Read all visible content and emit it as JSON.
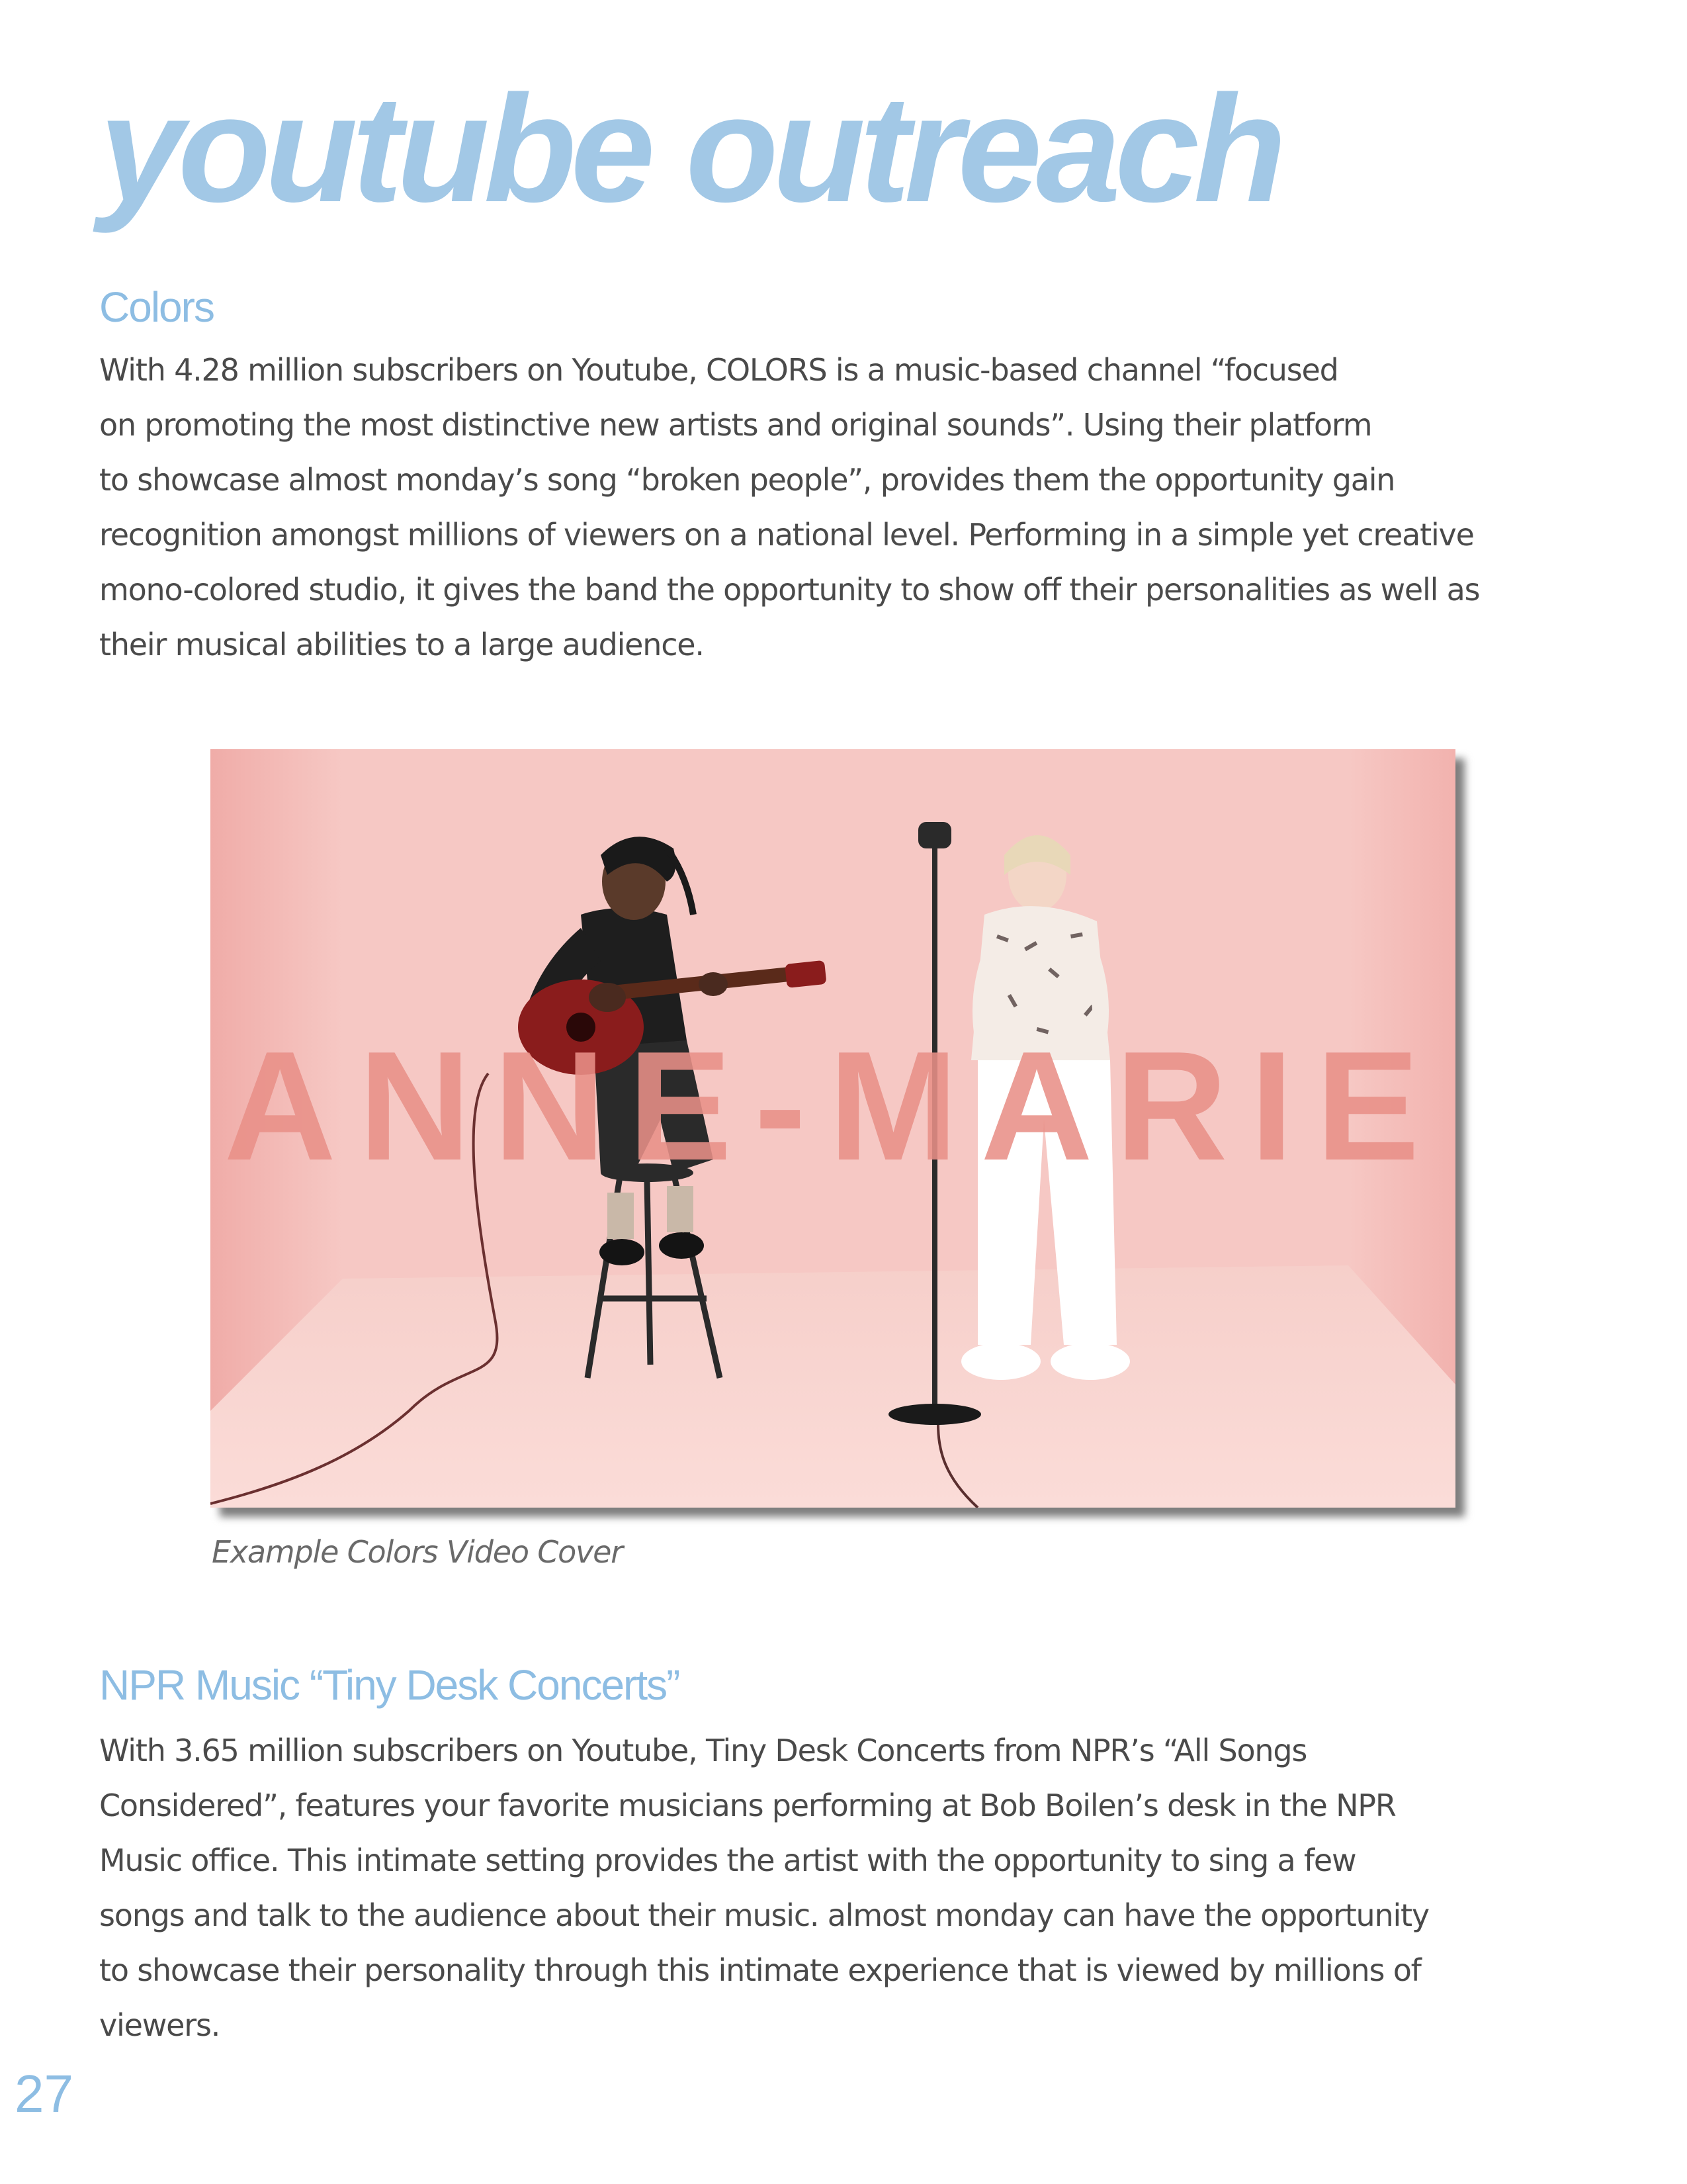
{
  "page": {
    "title": "youtube outreach",
    "page_number": "27"
  },
  "colors_section": {
    "heading": "Colors",
    "lines": [
      "With 4.28 million subscribers on Youtube, COLORS is a music-based channel “focused",
      "on promoting the most distinctive new artists and original sounds”. Using their platform",
      "to showcase almost monday’s song “broken people”, provides them the opportunity gain",
      "recognition amongst millions of viewers on a national level. Performing in a simple yet creative",
      "mono-colored studio, it gives the band the opportunity to show off their personalities as well as",
      "their musical abilities to a large audience."
    ]
  },
  "video_cover": {
    "overlay_text": "ANNE-MARIE",
    "caption": "Example Colors Video Cover",
    "colors": {
      "background": "#f4c4c0",
      "overlay_text": "#e89088"
    }
  },
  "npr_section": {
    "heading": "NPR Music “Tiny Desk Concerts”",
    "lines": [
      "With 3.65 million subscribers on Youtube, Tiny Desk Concerts from NPR’s “All Songs",
      "Considered”, features your favorite musicians performing at Bob Boilen’s desk in the NPR",
      "Music office. This intimate setting provides the artist with the opportunity to sing a few",
      "songs and talk to the audience about their music. almost monday can have the opportunity",
      "to showcase their personality through this intimate experience that is viewed by millions of",
      "viewers."
    ]
  },
  "theme": {
    "accent": "#8dbde3",
    "title_color": "#a2c8e6",
    "body_text": "#4a4a4a"
  }
}
